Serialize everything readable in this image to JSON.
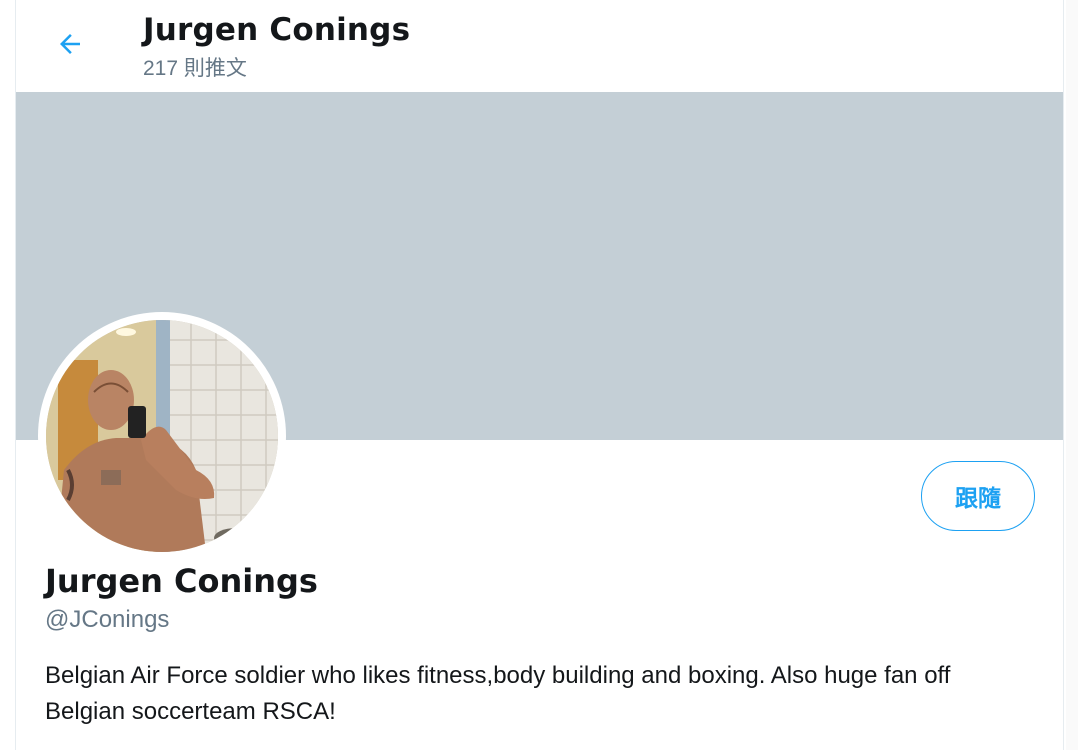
{
  "header": {
    "title": "Jurgen Conings",
    "tweet_count": "217 則推文"
  },
  "profile": {
    "display_name": "Jurgen Conings",
    "handle": "@JConings",
    "bio": "Belgian Air Force soldier who likes fitness,body building and boxing. Also huge fan off Belgian soccerteam RSCA!",
    "follow_label": "跟隨"
  },
  "icons": {
    "back": "back-arrow-icon"
  },
  "colors": {
    "accent": "#1da1f2",
    "banner": "#c4cfd6",
    "secondary_text": "#657786"
  }
}
